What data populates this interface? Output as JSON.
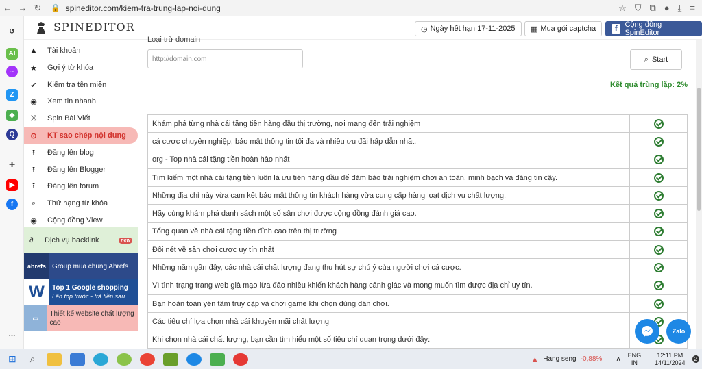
{
  "browser": {
    "url": "spineditor.com/kiem-tra-trung-lap-noi-dung"
  },
  "header": {
    "logo_text": "SPINEDITOR",
    "expiry": "Ngày hết hạn 17-11-2025",
    "captcha": "Mua gói captcha",
    "community": "Cộng đồng SpinEditor"
  },
  "menu": {
    "items": [
      {
        "label": "Tài khoản"
      },
      {
        "label": "Gợi ý từ khóa"
      },
      {
        "label": "Kiểm tra tên miền"
      },
      {
        "label": "Xem tin nhanh"
      },
      {
        "label": "Spin Bài Viết"
      },
      {
        "label": "KT sao chép nội dung"
      },
      {
        "label": "Đăng lên blog"
      },
      {
        "label": "Đăng lên Blogger"
      },
      {
        "label": "Đăng lên forum"
      },
      {
        "label": "Thứ hạng từ khóa"
      },
      {
        "label": "Cộng đồng View"
      }
    ],
    "backlink": "Dịch vụ backlink",
    "new_badge": "new",
    "promo1": {
      "thumb": "ahrefs",
      "text": "Group mua chung Ahrefs"
    },
    "promo2": {
      "title": "Top 1 Google shopping",
      "sub": "Lên top trước - trả tiền sau"
    },
    "promo3": {
      "text": "Thiết kế website chất lượng cao"
    }
  },
  "main": {
    "exclude_label": "Loại trừ domain",
    "domain_placeholder": "http://domain.com",
    "start_label": "Start",
    "result": "Kết quả trùng lặp: 2%",
    "rows": [
      "Khám phá từng nhà cái tặng tiền hàng đầu thị trường, nơi mang đến trải nghiệm",
      "cá cược chuyên nghiệp, bảo mật thông tin tối đa và nhiều ưu đãi hấp dẫn nhất.",
      "org - Top nhà cái tặng tiền hoàn hảo nhất",
      "Tìm kiếm một nhà cái tặng tiền luôn là ưu tiên hàng đầu để đảm bảo trải nghiệm chơi an toàn, minh bạch và đáng tin cậy.",
      "Những địa chỉ này vừa cam kết bảo mật thông tin khách hàng vừa cung cấp hàng loạt dịch vụ chất lượng.",
      "Hãy cùng khám phá danh sách một số sân chơi được cộng đồng đánh giá cao.",
      "Tổng quan về nhà cái tặng tiền đỉnh cao trên thị trường",
      "Đôi nét về sân chơi cược uy tín nhất",
      "Những năm gần đây, các nhà cái chất lượng đang thu hút sự chú ý của người chơi cá cược.",
      "Vì tình trạng trang web giả mạo lừa đảo nhiều khiến khách hàng cảnh giác và mong muốn tìm được địa chỉ uy tín.",
      "Bạn hoàn toàn yên tâm truy cập và chơi game khi chọn đúng dân chơi.",
      "Các tiêu chí lựa chọn nhà cái khuyến mãi chất lượng",
      "Khi chọn nhà cái chất lượng, bạn cần tìm hiểu một số tiêu chí quan trọng dưới đây:"
    ]
  },
  "floating": {
    "zalo": "Zalo"
  },
  "taskbar": {
    "stock_name": "Hang seng",
    "stock_change": "-0,88%",
    "lang1": "ENG",
    "lang2": "IN",
    "time": "12:11 PM",
    "date": "14/11/2024",
    "notif_count": "2"
  },
  "colors": {
    "active": "#d2322d",
    "active_bg": "#f7b9b6",
    "ok": "#2e7d32",
    "result": "#2e8b2e"
  }
}
